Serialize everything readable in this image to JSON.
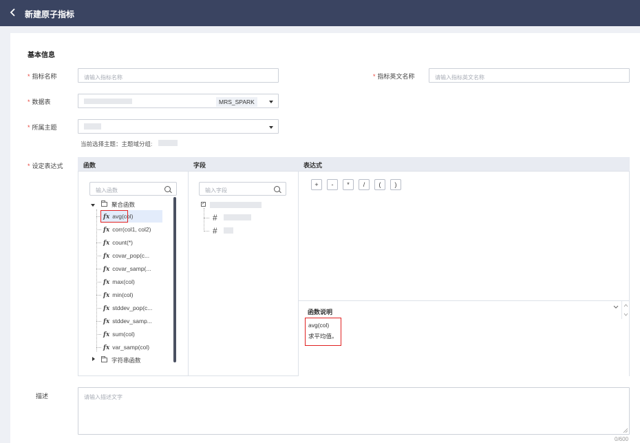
{
  "header": {
    "back_icon": "chevron-left-icon",
    "title": "新建原子指标"
  },
  "section_title": "基本信息",
  "form": {
    "required_mark": "*",
    "name": {
      "label": "指标名称",
      "placeholder": "请输入指标名称"
    },
    "name_en": {
      "label": "指标英文名称",
      "placeholder": "请输入指标英文名称"
    },
    "table": {
      "label": "数据表",
      "tag": "MRS_SPARK"
    },
    "theme": {
      "label": "所属主题",
      "hint": "当前选择主题：主题域分组:"
    },
    "expr": {
      "label": "设定表达式"
    },
    "desc": {
      "label": "描述",
      "placeholder": "请输入描述文字",
      "counter": "0/600"
    }
  },
  "columns": {
    "functions": "函数",
    "fields": "字段",
    "expression": "表达式"
  },
  "function_panel": {
    "search_placeholder": "输入函数",
    "group_agg": "聚合函数",
    "items": [
      "avg(col)",
      "corr(col1, col2)",
      "count(*)",
      "covar_pop(c...",
      "covar_samp(...",
      "max(col)",
      "min(col)",
      "stddev_pop(c...",
      "stddev_samp...",
      "sum(col)",
      "var_samp(col)"
    ],
    "fx_label": "fx",
    "group_string": "字符串函数",
    "selected_index": 0
  },
  "field_panel": {
    "search_placeholder": "输入字段",
    "hash": "#"
  },
  "operators": [
    "+",
    "-",
    "*",
    "/",
    "(",
    ")"
  ],
  "func_desc": {
    "title": "函数说明",
    "line1": "avg(col)",
    "line2": "求平均值。"
  },
  "colors": {
    "topbar": "#3a4461",
    "required": "#e8453c",
    "highlight": "#e02020",
    "selected_bg": "#e3ecfb"
  }
}
